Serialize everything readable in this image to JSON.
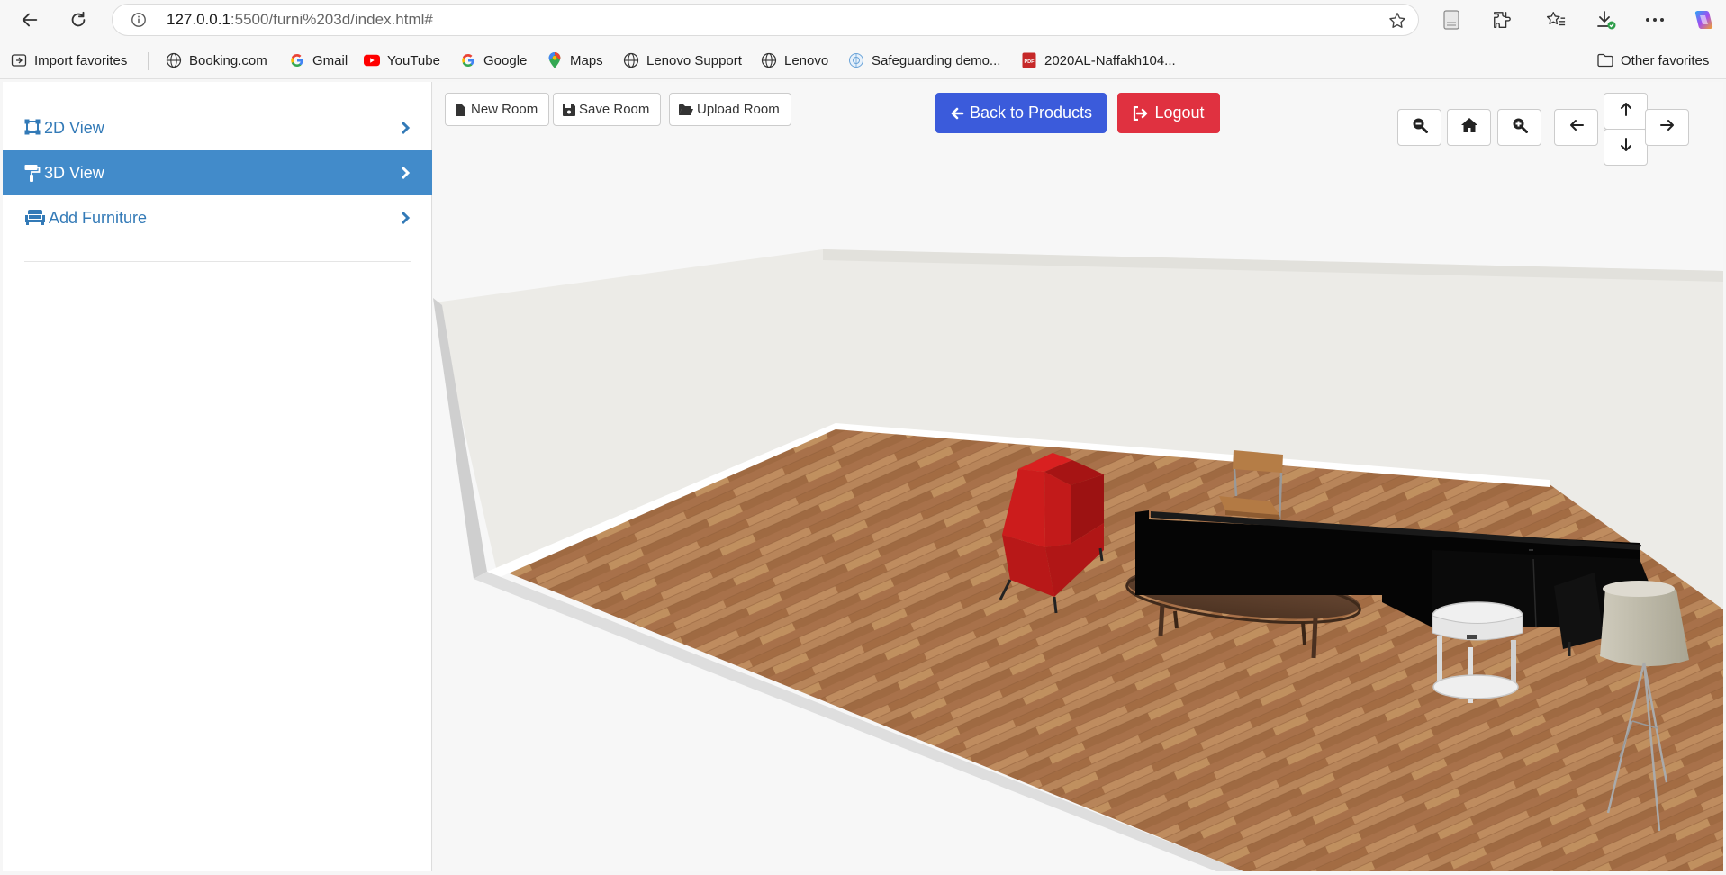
{
  "browser": {
    "url_host": "127.0.0.1",
    "url_rest": ":5500/furni%203d/index.html#",
    "icons": [
      "back-icon",
      "reload-icon",
      "info-icon",
      "star-icon",
      "reading-icon",
      "extensions-icon",
      "favorites-icon",
      "downloads-icon",
      "more-icon",
      "copilot-icon"
    ]
  },
  "bookmarks": [
    {
      "label": "Import favorites",
      "icon": "import-icon"
    },
    {
      "label": "Booking.com",
      "icon": "globe-icon"
    },
    {
      "label": "Gmail",
      "icon": "google-icon"
    },
    {
      "label": "YouTube",
      "icon": "youtube-icon"
    },
    {
      "label": "Google",
      "icon": "google-icon"
    },
    {
      "label": "Maps",
      "icon": "maps-icon"
    },
    {
      "label": "Lenovo Support",
      "icon": "globe-icon"
    },
    {
      "label": "Lenovo",
      "icon": "globe-icon"
    },
    {
      "label": "Safeguarding demo...",
      "icon": "un-icon"
    },
    {
      "label": "2020AL-Naffakh104...",
      "icon": "pdf-icon"
    },
    {
      "label": "Other favorites",
      "icon": "folder-icon"
    }
  ],
  "sidebar": {
    "items": [
      {
        "label": "2D View",
        "icon": "vector-square-icon",
        "active": false
      },
      {
        "label": "3D View",
        "icon": "paint-roller-icon",
        "active": true
      },
      {
        "label": "Add Furniture",
        "icon": "couch-icon",
        "active": false
      }
    ]
  },
  "toolbar": {
    "new_room": "New Room",
    "save_room": "Save Room",
    "upload_room": "Upload Room",
    "back_to_products": "Back to Products",
    "logout": "Logout"
  },
  "camera_controls": [
    "zoom-out-icon",
    "home-icon",
    "zoom-in-icon",
    "arrow-left-icon",
    "arrow-up-icon",
    "arrow-down-icon",
    "arrow-right-icon"
  ],
  "colors": {
    "sidebar_active": "#428bca",
    "link": "#337ab7",
    "back_button": "#3b5bdb",
    "logout_button": "#e03140",
    "floor": "#b07a4c"
  }
}
